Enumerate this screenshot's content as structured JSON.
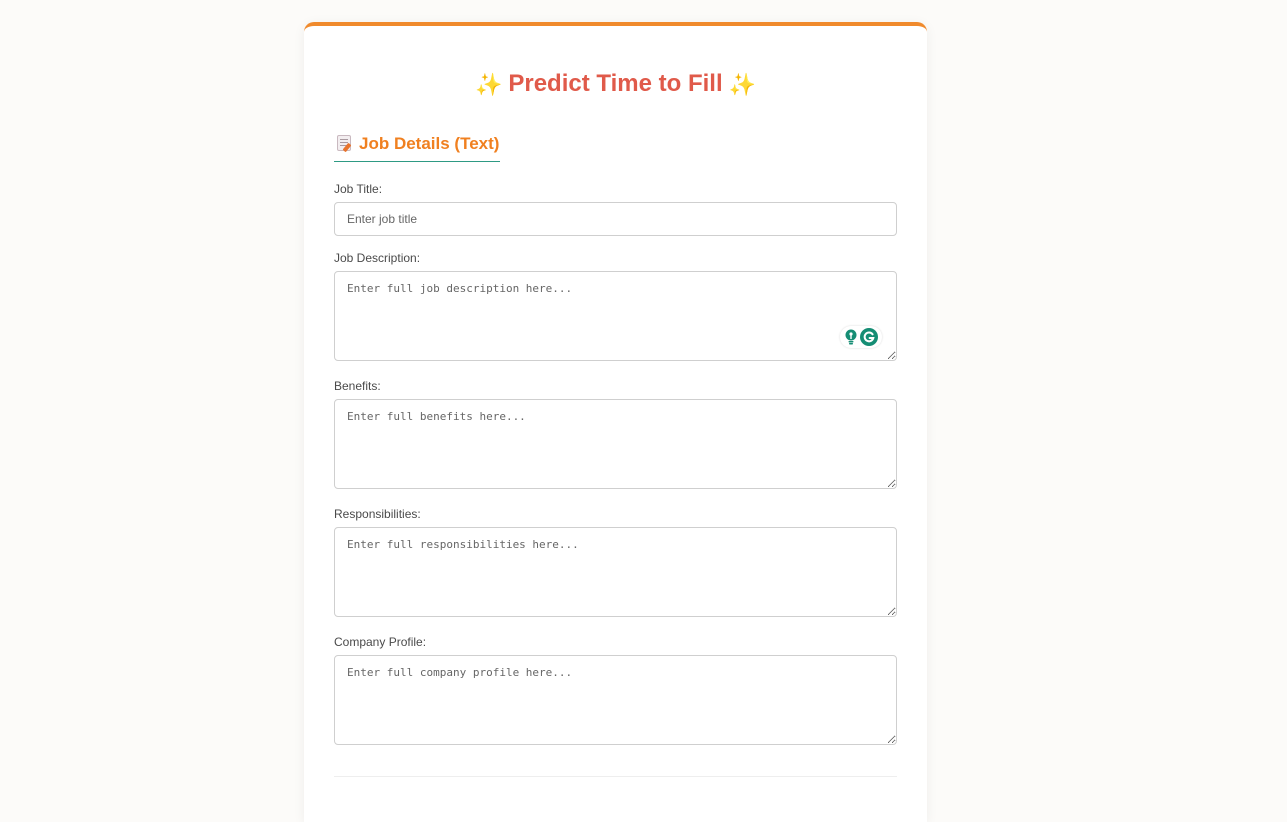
{
  "page": {
    "title": "Predict Time to Fill",
    "title_icon": "sparkles"
  },
  "section": {
    "heading": "Job Details (Text)",
    "icon": "memo"
  },
  "fields": {
    "job_title": {
      "label": "Job Title:",
      "placeholder": "Enter job title",
      "value": ""
    },
    "job_description": {
      "label": "Job Description:",
      "placeholder": "Enter full job description here...",
      "value": ""
    },
    "benefits": {
      "label": "Benefits:",
      "placeholder": "Enter full benefits here...",
      "value": ""
    },
    "responsibilities": {
      "label": "Responsibilities:",
      "placeholder": "Enter full responsibilities here...",
      "value": ""
    },
    "company_profile": {
      "label": "Company Profile:",
      "placeholder": "Enter full company profile here...",
      "value": ""
    }
  },
  "grammar_widget": {
    "icons": [
      "lightbulb-icon",
      "grammarly-icon"
    ]
  },
  "colors": {
    "accent": "#f08a2c",
    "title": "#e05a4a",
    "heading": "#f08020",
    "underline": "#2e9a84",
    "widget": "#158d74"
  }
}
